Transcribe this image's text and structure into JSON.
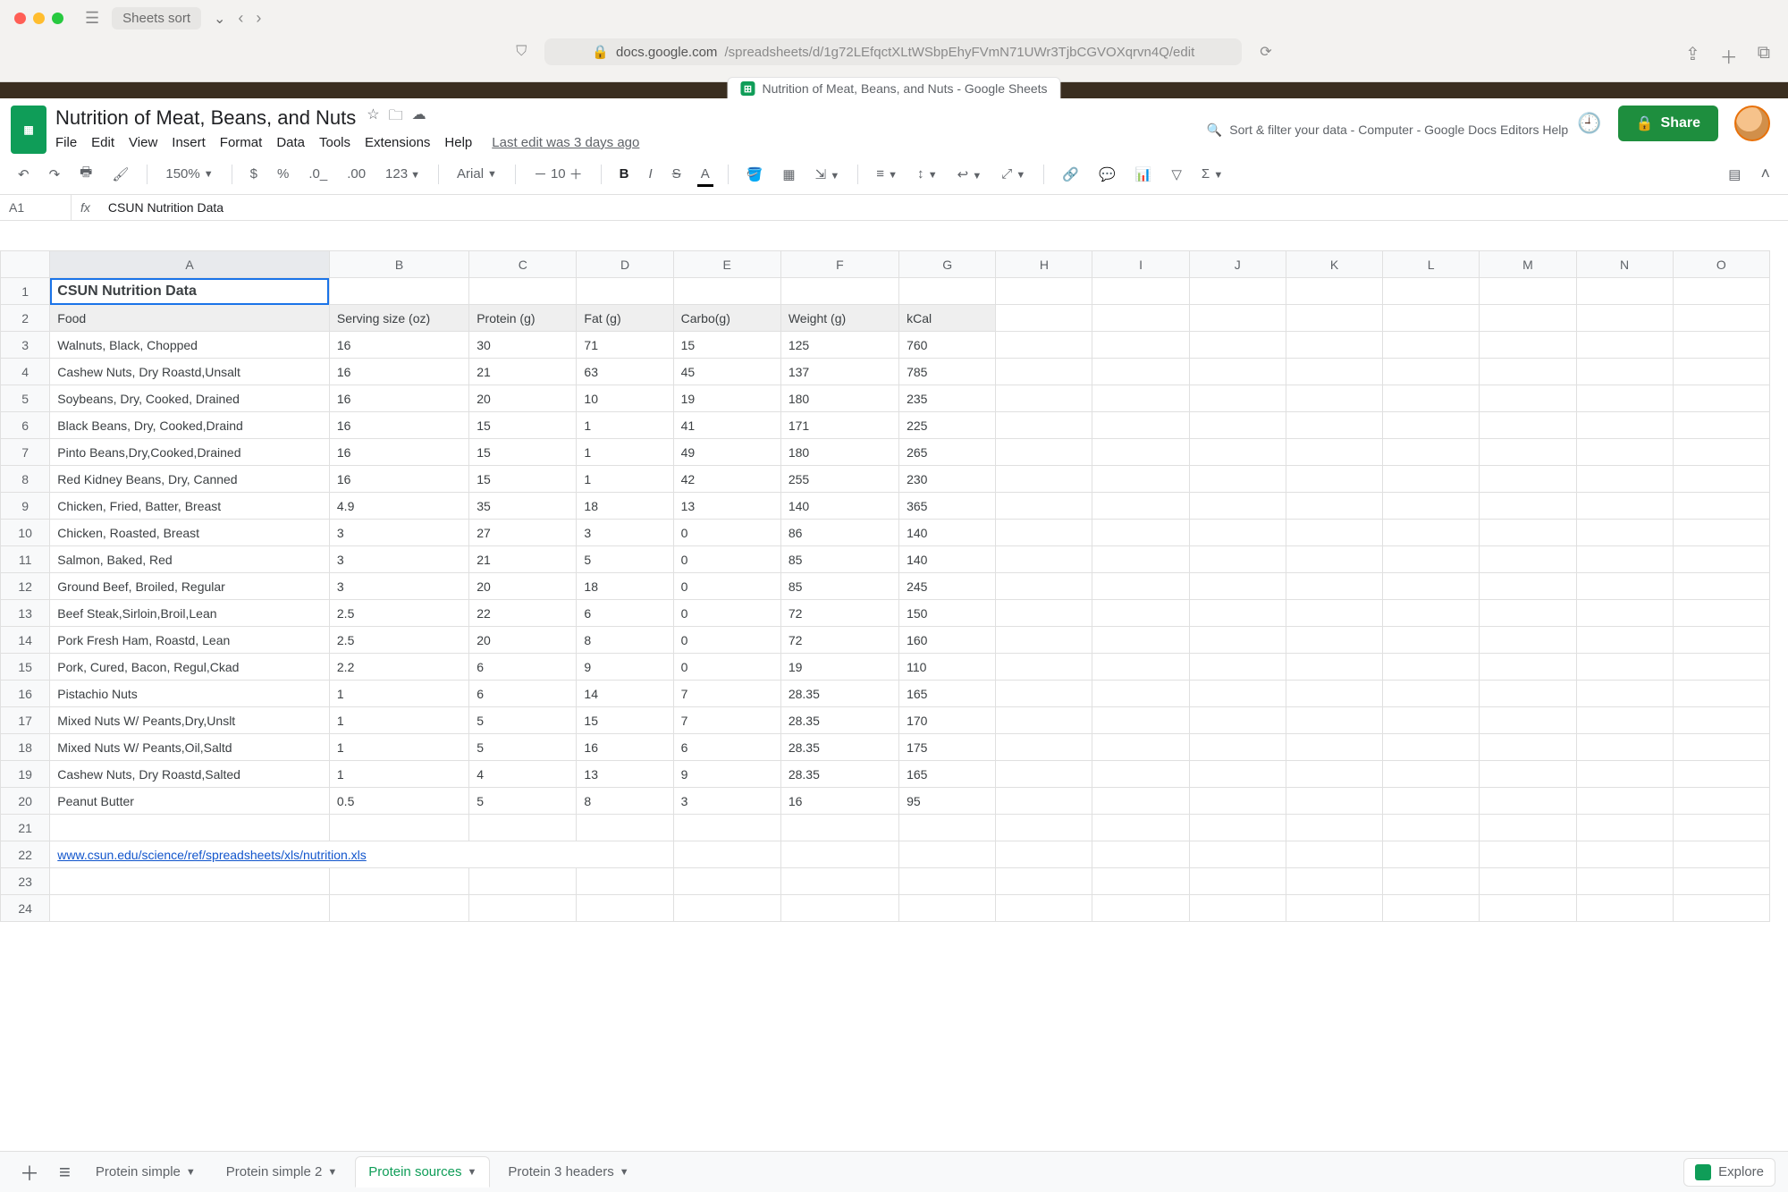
{
  "browser": {
    "tab_group_label": "Sheets sort",
    "url_host": "docs.google.com",
    "url_path": "/spreadsheets/d/1g72LEfqctXLtWSbpEhyFVmN71UWr3TjbCGVOXqrvn4Q/edit",
    "lock_icon": "🔒",
    "page_tab_title": "Nutrition of Meat, Beans, and Nuts - Google Sheets"
  },
  "doc": {
    "title": "Nutrition of Meat, Beans, and Nuts",
    "menus": [
      "File",
      "Edit",
      "View",
      "Insert",
      "Format",
      "Data",
      "Tools",
      "Extensions",
      "Help"
    ],
    "last_edit": "Last edit was 3 days ago",
    "help_search": "Sort & filter your data - Computer - Google Docs Editors Help",
    "share": "Share"
  },
  "toolbar": {
    "zoom": "150%",
    "currency": "$",
    "percent": "%",
    "decimals": ".0 .00",
    "format": "123",
    "font": "Arial",
    "fontsize": "10",
    "bold": "B",
    "italic": "I",
    "strike": "S",
    "colorA": "A"
  },
  "fx": {
    "namebox": "A1",
    "label": "fx",
    "value": "CSUN Nutrition Data"
  },
  "columns": [
    "A",
    "B",
    "C",
    "D",
    "E",
    "F",
    "G",
    "H",
    "I",
    "J",
    "K",
    "L",
    "M",
    "N",
    "O"
  ],
  "sheet": {
    "title_cell": "CSUN Nutrition Data",
    "row2_label": "Food",
    "headers": [
      "Serving size (oz)",
      "Protein (g)",
      "Fat (g)",
      "Carbo(g)",
      "Weight (g)",
      "kCal"
    ],
    "rows": [
      {
        "food": "Walnuts, Black, Chopped",
        "vals": [
          "16",
          "30",
          "71",
          "15",
          "125",
          "760"
        ]
      },
      {
        "food": "Cashew Nuts, Dry Roastd,Unsalt",
        "vals": [
          "16",
          "21",
          "63",
          "45",
          "137",
          "785"
        ]
      },
      {
        "food": "Soybeans, Dry, Cooked, Drained",
        "vals": [
          "16",
          "20",
          "10",
          "19",
          "180",
          "235"
        ]
      },
      {
        "food": "Black Beans, Dry, Cooked,Draind",
        "vals": [
          "16",
          "15",
          "1",
          "41",
          "171",
          "225"
        ]
      },
      {
        "food": "Pinto Beans,Dry,Cooked,Drained",
        "vals": [
          "16",
          "15",
          "1",
          "49",
          "180",
          "265"
        ]
      },
      {
        "food": "Red Kidney Beans, Dry, Canned",
        "vals": [
          "16",
          "15",
          "1",
          "42",
          "255",
          "230"
        ]
      },
      {
        "food": "Chicken, Fried, Batter, Breast",
        "vals": [
          "4.9",
          "35",
          "18",
          "13",
          "140",
          "365"
        ]
      },
      {
        "food": "Chicken, Roasted, Breast",
        "vals": [
          "3",
          "27",
          "3",
          "0",
          "86",
          "140"
        ]
      },
      {
        "food": "Salmon, Baked, Red",
        "vals": [
          "3",
          "21",
          "5",
          "0",
          "85",
          "140"
        ]
      },
      {
        "food": "Ground Beef, Broiled, Regular",
        "vals": [
          "3",
          "20",
          "18",
          "0",
          "85",
          "245"
        ]
      },
      {
        "food": "Beef Steak,Sirloin,Broil,Lean",
        "vals": [
          "2.5",
          "22",
          "6",
          "0",
          "72",
          "150"
        ]
      },
      {
        "food": "Pork Fresh Ham, Roastd, Lean",
        "vals": [
          "2.5",
          "20",
          "8",
          "0",
          "72",
          "160"
        ]
      },
      {
        "food": "Pork, Cured, Bacon, Regul,Ckad",
        "vals": [
          "2.2",
          "6",
          "9",
          "0",
          "19",
          "110"
        ]
      },
      {
        "food": "Pistachio Nuts",
        "vals": [
          "1",
          "6",
          "14",
          "7",
          "28.35",
          "165"
        ]
      },
      {
        "food": "Mixed Nuts W/ Peants,Dry,Unslt",
        "vals": [
          "1",
          "5",
          "15",
          "7",
          "28.35",
          "170"
        ]
      },
      {
        "food": "Mixed Nuts W/ Peants,Oil,Saltd",
        "vals": [
          "1",
          "5",
          "16",
          "6",
          "28.35",
          "175"
        ]
      },
      {
        "food": "Cashew Nuts, Dry Roastd,Salted",
        "vals": [
          "1",
          "4",
          "13",
          "9",
          "28.35",
          "165"
        ]
      },
      {
        "food": "Peanut Butter",
        "vals": [
          "0.5",
          "5",
          "8",
          "3",
          "16",
          "95"
        ]
      }
    ],
    "link_text": "www.csun.edu/science/ref/spreadsheets/xls/nutrition.xls"
  },
  "tabs": {
    "list": [
      "Protein simple",
      "Protein simple 2",
      "Protein sources",
      "Protein 3 headers"
    ],
    "active_index": 2,
    "explore": "Explore"
  }
}
